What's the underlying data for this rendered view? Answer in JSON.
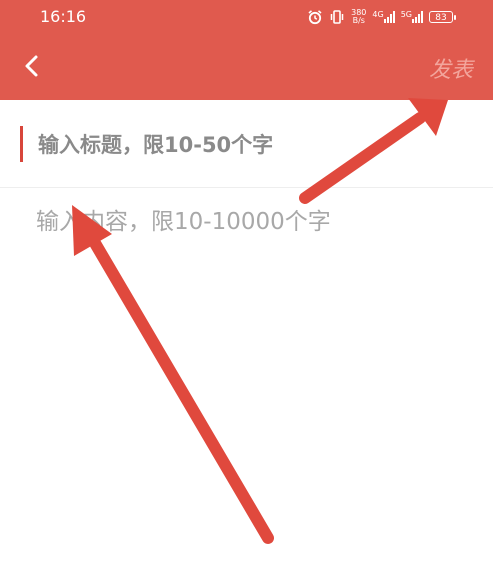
{
  "status_bar": {
    "time": "16:16",
    "net_speed_value": "380",
    "net_speed_unit": "B/s",
    "sim1_label": "4G",
    "sim2_label": "5G",
    "battery": "83"
  },
  "header": {
    "back_icon": "chevron-left-icon",
    "publish_label": "发表",
    "background_color": "#e05a4e"
  },
  "editor": {
    "title_placeholder": "输入标题，限10-50个字",
    "content_placeholder": "输入内容，限10-10000个字"
  },
  "annotations": {
    "arrow_color": "#e0493d"
  }
}
